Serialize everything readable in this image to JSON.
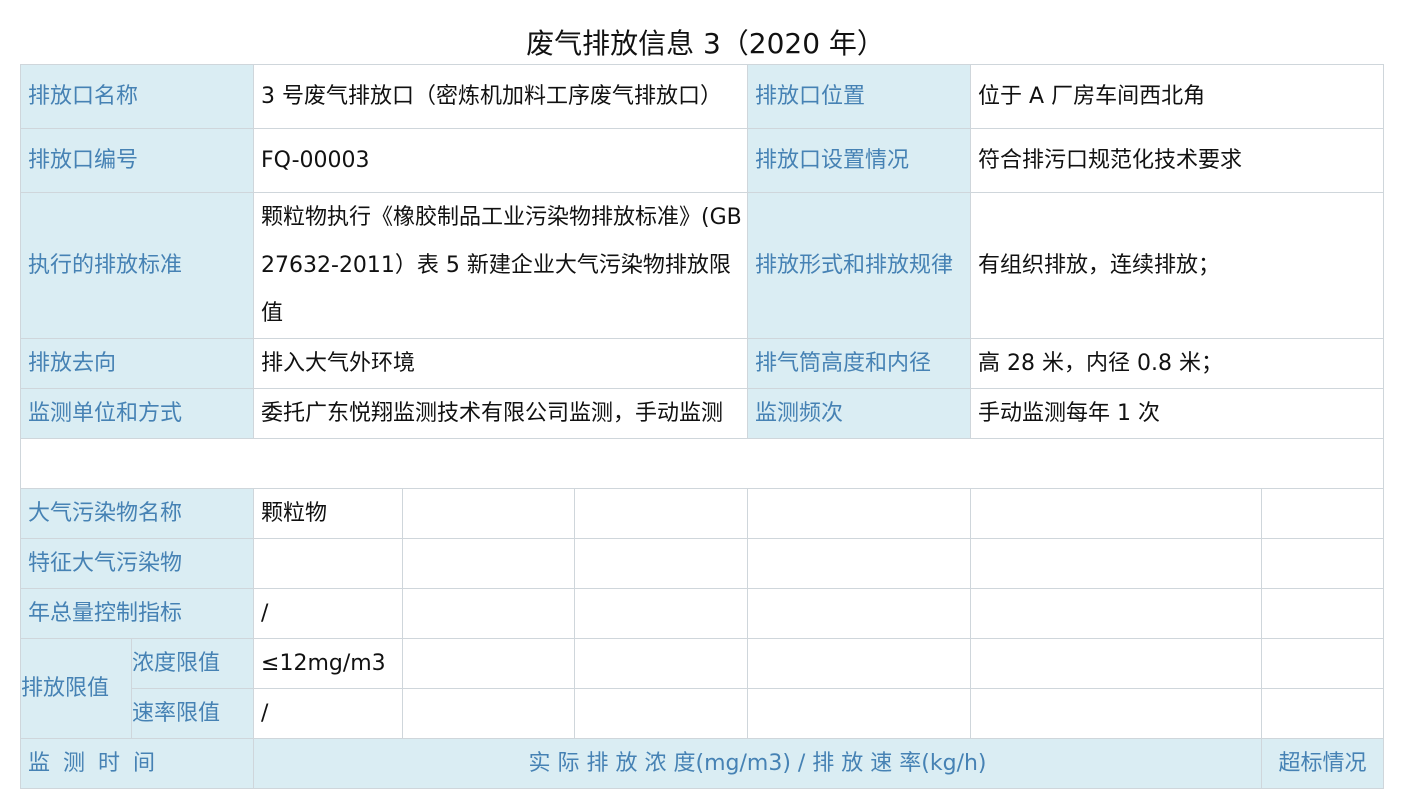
{
  "title": "废气排放信息 3（2020 年）",
  "outlet_info": {
    "name_label": "排放口名称",
    "name_value": "3 号废气排放口（密炼机加料工序废气排放口）",
    "location_label": "排放口位置",
    "location_value": "位于 A 厂房车间西北角",
    "code_label": "排放口编号",
    "code_value": "FQ-00003",
    "setting_label": "排放口设置情况",
    "setting_value": "符合排污口规范化技术要求",
    "standard_label": "执行的排放标准",
    "standard_value": "颗粒物执行《橡胶制品工业污染物排放标准》(GB 27632-2011）表 5 新建企业大气污染物排放限值",
    "pattern_label": "排放形式和排放规律",
    "pattern_value": "有组织排放，连续排放；",
    "direction_label": "排放去向",
    "direction_value": "排入大气外环境",
    "stack_label": "排气筒高度和内径",
    "stack_value": "高 28 米，内径 0.8 米；",
    "monitor_unit_label": "监测单位和方式",
    "monitor_unit_value": "委托广东悦翔监测技术有限公司监测，手动监测",
    "frequency_label": "监测频次",
    "frequency_value": "手动监测每年 1 次"
  },
  "pollutant": {
    "name_label": "大气污染物名称",
    "name_value": "颗粒物",
    "feature_label": "特征大气污染物",
    "feature_value": "",
    "annual_label": "年总量控制指标",
    "annual_value": "/",
    "limit_label": "排放限值",
    "conc_label": "浓度限值",
    "conc_value": "≤12mg/m3",
    "rate_label": "速率限值",
    "rate_value": "/"
  },
  "monitor_header": {
    "time_label": "监 测 时 间",
    "measure_label": "实 际 排 放 浓 度(mg/m3) / 排 放 速 率(kg/h)",
    "exceed_label": "超标情况"
  }
}
